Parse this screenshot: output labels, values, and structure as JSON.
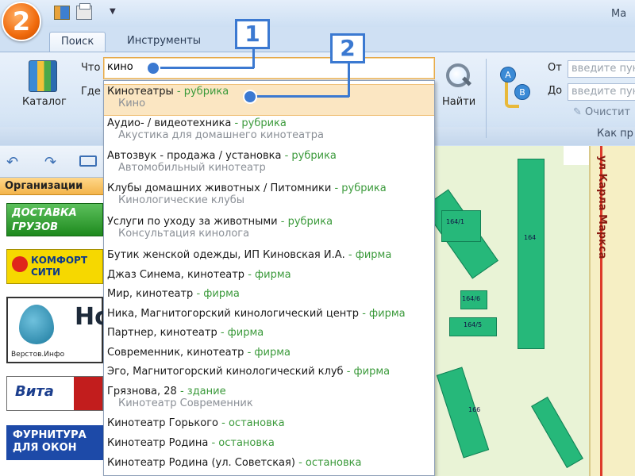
{
  "app": {
    "logo_text": "2",
    "title_fragment": "Ма"
  },
  "ribbon": {
    "tabs": [
      {
        "label": "Поиск"
      },
      {
        "label": "Инструменты"
      }
    ],
    "catalog_label": "Каталог",
    "what_label": "Что",
    "where_label": "Где",
    "search_value": "кино",
    "find_label": "Найти",
    "from_label": "От",
    "to_label": "До",
    "from_placeholder": "введите пун",
    "to_placeholder": "введите пун",
    "clear_label": "Очистит",
    "route_group_label": "Как пр"
  },
  "sidebar": {
    "header": "Организации",
    "ads": [
      {
        "line1": "ДОСТАВКА",
        "line2": "ГРУЗОВ"
      },
      {
        "line1": "КОМФОРТ",
        "line2": "СИТИ"
      },
      {
        "big": "Но",
        "small": "Верстов.Инфо"
      },
      {
        "text": "Вита"
      },
      {
        "line1": "ФУРНИТУРА",
        "line2": "ДЛЯ ОКОН"
      }
    ]
  },
  "suggestions": [
    {
      "name": "Кинотеатры",
      "type": "- рубрика",
      "sub": "Кино",
      "selected": true
    },
    {
      "name": "Аудио- / видеотехника",
      "type": "- рубрика",
      "sub": "Акустика для домашнего кинотеатра"
    },
    {
      "name": "Автозвук - продажа / установка",
      "type": "- рубрика",
      "sub": "Автомобильный кинотеатр"
    },
    {
      "name": "Клубы домашних животных / Питомники",
      "type": "- рубрика",
      "sub": "Кинологические клубы"
    },
    {
      "name": "Услуги по уходу за животными",
      "type": "- рубрика",
      "sub": "Консультация кинолога"
    },
    {
      "name": "Бутик женской одежды, ИП Киновская И.А.",
      "type": "- фирма"
    },
    {
      "name": "Джаз Синема, кинотеатр",
      "type": "- фирма"
    },
    {
      "name": "Мир, кинотеатр",
      "type": "- фирма"
    },
    {
      "name": "Ника, Магнитогорский кинологический центр",
      "type": "- фирма"
    },
    {
      "name": "Партнер, кинотеатр",
      "type": "- фирма"
    },
    {
      "name": "Современник, кинотеатр",
      "type": "- фирма"
    },
    {
      "name": "Эго, Магнитогорский кинологический клуб",
      "type": "- фирма"
    },
    {
      "name": "Грязнова, 28",
      "type": "- здание",
      "sub": "Кинотеатр Современник"
    },
    {
      "name": "Кинотеатр Горького",
      "type": "- остановка"
    },
    {
      "name": "Кинотеатр Родина",
      "type": "- остановка"
    },
    {
      "name": "Кинотеатр Родина (ул. Советская)",
      "type": "- остановка"
    }
  ],
  "map": {
    "street_name": "ул Карла Маркса",
    "building_labels": [
      "164/1",
      "164",
      "164/6",
      "164/5",
      "166"
    ]
  },
  "callouts": {
    "one": "1",
    "two": "2"
  },
  "colors": {
    "accent": "#3b79d1",
    "type_green": "#3b9a3b",
    "selection": "#fbe6c2"
  },
  "icons": [
    "app-logo",
    "gis-icon",
    "print-icon",
    "catalog-icon",
    "find-icon",
    "route-icon",
    "clear-icon",
    "back-arrow-icon",
    "forward-arrow-icon"
  ]
}
